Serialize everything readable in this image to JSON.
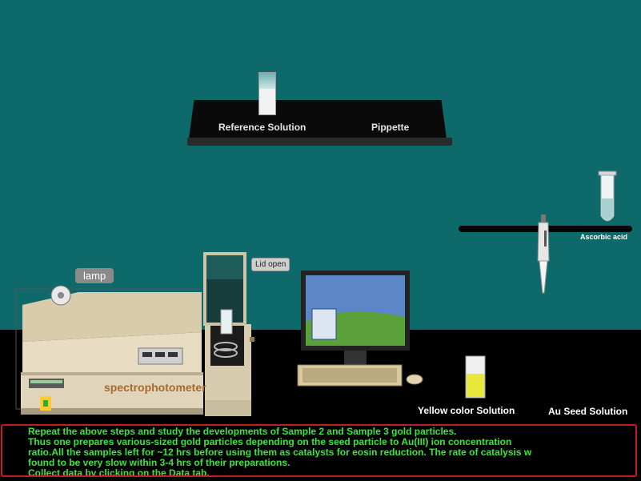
{
  "shelf": {
    "reference_label": "Reference Solution",
    "pipette_label": "Pippette"
  },
  "right_shelf": {
    "ascorbic_label": "Ascorbic acid"
  },
  "bench": {
    "yellow_label": "Yellow color Solution",
    "seed_label": "Au Seed Solution",
    "lid_tag": "Lid open",
    "lamp_tag": "lamp",
    "instrument_label": "spectrophotometer"
  },
  "instructions": {
    "lines": [
      "Repeat the above steps and study the developments of Sample 2 and Sample 3 gold particles.",
      "Thus one prepares various-sized gold particles depending on the seed particle to Au(III) ion concentration",
      "ratio.All the samples left for ~12 hrs before using them as catalysts for eosin reduction. The rate of catalysis w",
      "found to be very slow within 3-4 hrs of their preparations.",
      "Collect data by clicking on the Data tab."
    ]
  },
  "colors": {
    "background": "#0e6a6a",
    "floor": "#000000",
    "info_text": "#39e639",
    "info_border": "#c21c1c",
    "yellow_solution": "#e8e83a"
  }
}
